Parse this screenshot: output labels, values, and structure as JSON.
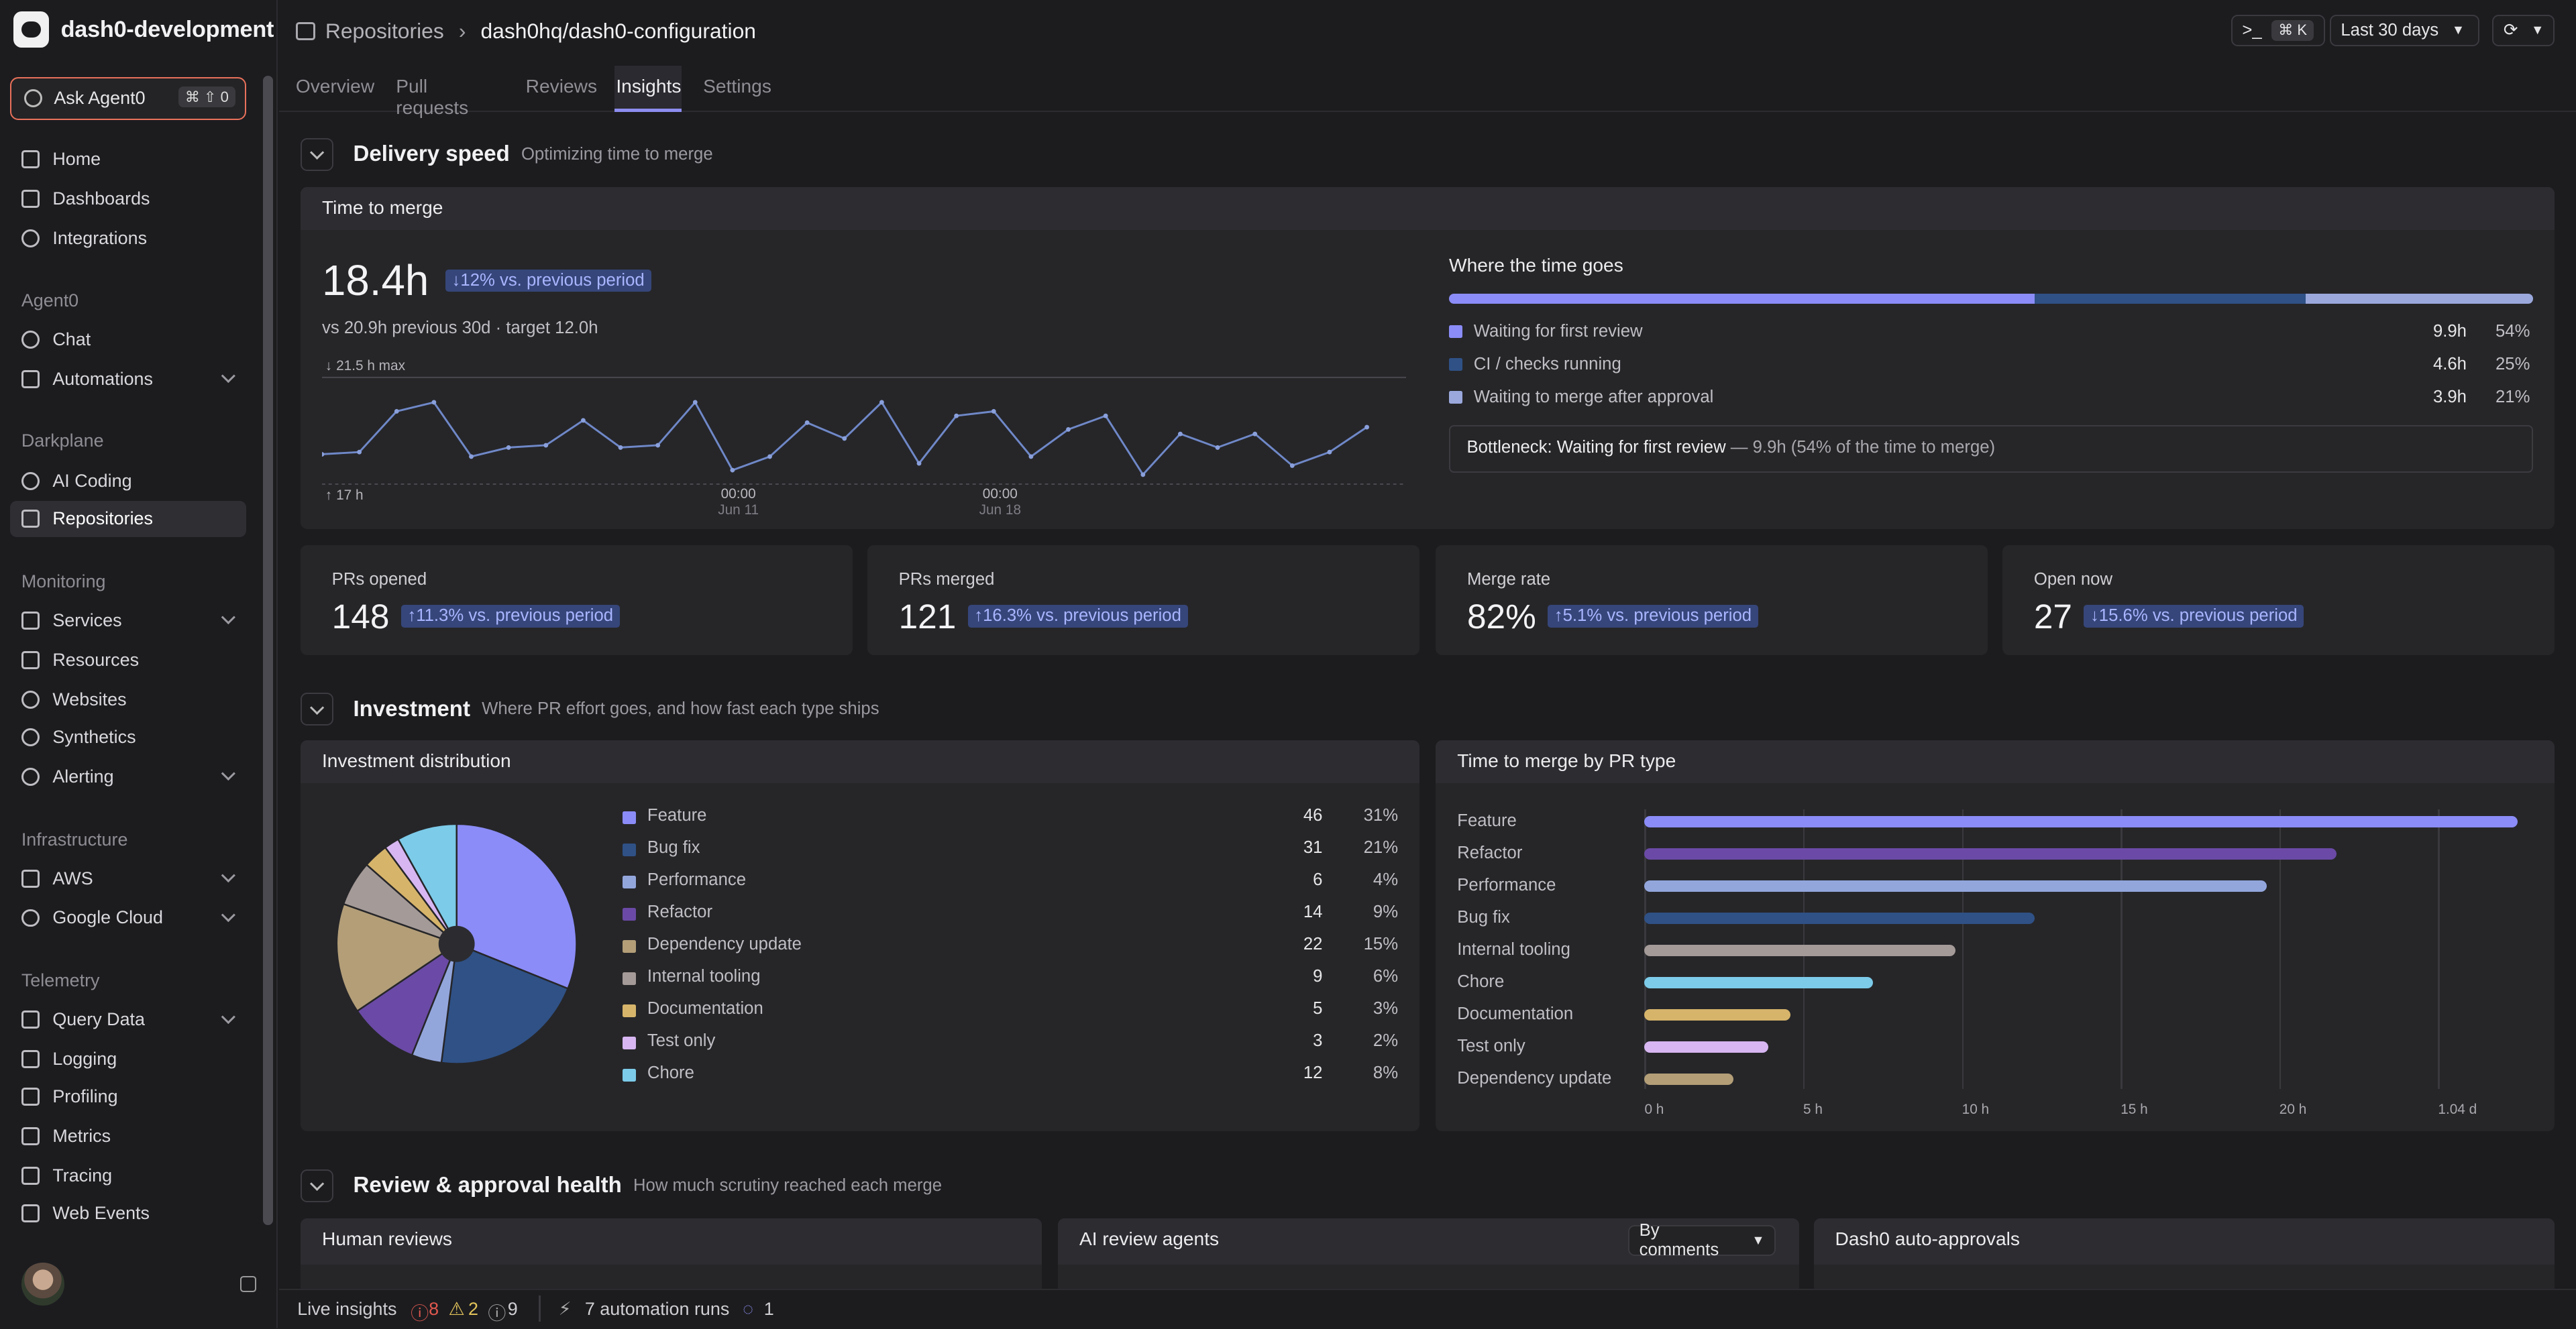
{
  "app": {
    "workspace": "dash0-development"
  },
  "agent": {
    "label": "Ask Agent0",
    "shortcut": "⌘ ⇧ 0"
  },
  "sidebar": {
    "top": [
      {
        "label": "Home"
      },
      {
        "label": "Dashboards"
      },
      {
        "label": "Integrations"
      }
    ],
    "sections": {
      "agent0": "Agent0",
      "darkplane": "Darkplane",
      "monitoring": "Monitoring",
      "infrastructure": "Infrastructure",
      "telemetry": "Telemetry"
    },
    "agent0_items": [
      {
        "label": "Chat"
      },
      {
        "label": "Automations"
      }
    ],
    "darkplane_items": [
      {
        "label": "AI Coding"
      },
      {
        "label": "Repositories"
      }
    ],
    "monitoring_items": [
      {
        "label": "Services"
      },
      {
        "label": "Resources"
      },
      {
        "label": "Websites"
      },
      {
        "label": "Synthetics"
      },
      {
        "label": "Alerting"
      }
    ],
    "infrastructure_items": [
      {
        "label": "AWS"
      },
      {
        "label": "Google Cloud"
      }
    ],
    "telemetry_items": [
      {
        "label": "Query Data"
      },
      {
        "label": "Logging"
      },
      {
        "label": "Profiling"
      },
      {
        "label": "Metrics"
      },
      {
        "label": "Tracing"
      },
      {
        "label": "Web Events"
      }
    ]
  },
  "header": {
    "breadcrumb_root": "Repositories",
    "breadcrumb_repo": "dash0hq/dash0-configuration",
    "command_kbd": "⌘ K",
    "time_range": "Last 30 days",
    "tabs": [
      {
        "label": "Overview"
      },
      {
        "label": "Pull requests"
      },
      {
        "label": "Reviews"
      },
      {
        "label": "Insights"
      },
      {
        "label": "Settings"
      }
    ]
  },
  "delivery": {
    "title": "Delivery speed",
    "subtitle": "Optimizing time to merge",
    "ttm_title": "Time to merge",
    "value": "18.4h",
    "delta": "↓12% vs. previous period",
    "compare": "vs 20.9h previous 30d · target 12.0h",
    "max_label": "21.5 h max",
    "min_label": "17 h",
    "ticks": [
      {
        "time": "00:00",
        "date": "Jun 11"
      },
      {
        "time": "00:00",
        "date": "Jun 18"
      }
    ],
    "where_title": "Where the time goes",
    "where": [
      {
        "label": "Waiting for first review",
        "value": "9.9h",
        "pct": "54%",
        "share": 54,
        "color": "#8b8cf8"
      },
      {
        "label": "CI / checks running",
        "value": "4.6h",
        "pct": "25%",
        "share": 25,
        "color": "#2f5186"
      },
      {
        "label": "Waiting to merge after approval",
        "value": "3.9h",
        "pct": "21%",
        "share": 21,
        "color": "#9aa8dc"
      }
    ],
    "bottleneck_strong": "Bottleneck: Waiting for first review",
    "bottleneck_rest": "— 9.9h (54% of the time to merge)"
  },
  "kpis": [
    {
      "label": "PRs opened",
      "value": "148",
      "delta": "↑11.3% vs. previous period"
    },
    {
      "label": "PRs merged",
      "value": "121",
      "delta": "↑16.3% vs. previous period"
    },
    {
      "label": "Merge rate",
      "value": "82%",
      "delta": "↑5.1% vs. previous period"
    },
    {
      "label": "Open now",
      "value": "27",
      "delta": "↓15.6% vs. previous period"
    }
  ],
  "investment": {
    "title": "Investment",
    "subtitle": "Where PR effort goes, and how fast each type ships",
    "dist_title": "Investment distribution",
    "items": [
      {
        "label": "Feature",
        "count": "46",
        "pct": "31%",
        "value": 46,
        "color": "#8b8cf8"
      },
      {
        "label": "Bug fix",
        "count": "31",
        "pct": "21%",
        "value": 31,
        "color": "#2f5186"
      },
      {
        "label": "Performance",
        "count": "6",
        "pct": "4%",
        "value": 6,
        "color": "#93a6dc"
      },
      {
        "label": "Refactor",
        "count": "14",
        "pct": "9%",
        "value": 14,
        "color": "#6a4aa6"
      },
      {
        "label": "Dependency update",
        "count": "22",
        "pct": "15%",
        "value": 22,
        "color": "#b39e78"
      },
      {
        "label": "Internal tooling",
        "count": "9",
        "pct": "6%",
        "value": 9,
        "color": "#a49a98"
      },
      {
        "label": "Documentation",
        "count": "5",
        "pct": "3%",
        "value": 5,
        "color": "#d6b46a"
      },
      {
        "label": "Test only",
        "count": "3",
        "pct": "2%",
        "value": 3,
        "color": "#d7b6f2"
      },
      {
        "label": "Chore",
        "count": "12",
        "pct": "8%",
        "value": 12,
        "color": "#7ccbe9"
      }
    ]
  },
  "chart_data": [
    {
      "type": "line",
      "title": "Time to merge",
      "y_max_label": "21.5 h max",
      "y_min_label": "17 h",
      "ylim": [
        17,
        21.5
      ],
      "x_tick_labels": [
        "00:00 Jun 11",
        "00:00 Jun 18"
      ],
      "values": [
        18.1,
        18.2,
        20.0,
        20.4,
        18.0,
        18.4,
        18.5,
        19.6,
        18.4,
        18.5,
        20.4,
        17.4,
        18.0,
        19.5,
        18.8,
        20.4,
        17.7,
        19.8,
        20.0,
        18.0,
        19.2,
        19.8,
        17.2,
        19.0,
        18.4,
        19.0,
        17.6,
        18.2,
        19.3
      ]
    },
    {
      "type": "bar",
      "orientation": "horizontal",
      "title": "Time to merge by PR type",
      "categories": [
        "Feature",
        "Refactor",
        "Performance",
        "Bug fix",
        "Internal tooling",
        "Chore",
        "Documentation",
        "Test only",
        "Dependency update"
      ],
      "values": [
        27.5,
        21.8,
        19.6,
        12.3,
        9.8,
        7.2,
        4.6,
        3.9,
        2.8
      ],
      "colors": [
        "#8b8cf8",
        "#6a4aa6",
        "#93a6dc",
        "#2f5186",
        "#a49a98",
        "#7ccbe9",
        "#d6b46a",
        "#d7b6f2",
        "#b39e78"
      ],
      "x_tick_labels": [
        "0 h",
        "5 h",
        "10 h",
        "15 h",
        "20 h",
        "1.04 d"
      ],
      "xlim": [
        0,
        28
      ]
    }
  ],
  "bytype": {
    "title": "Time to merge by PR type"
  },
  "review": {
    "title": "Review & approval health",
    "subtitle": "How much scrutiny reached each merge",
    "human": "Human reviews",
    "ai": "AI review agents",
    "ai_select": "By comments",
    "auto": "Dash0 auto-approvals"
  },
  "status": {
    "live": "Live insights",
    "errors": "8",
    "warnings": "2",
    "info": "9",
    "runs": "7 automation runs",
    "running": "1"
  }
}
